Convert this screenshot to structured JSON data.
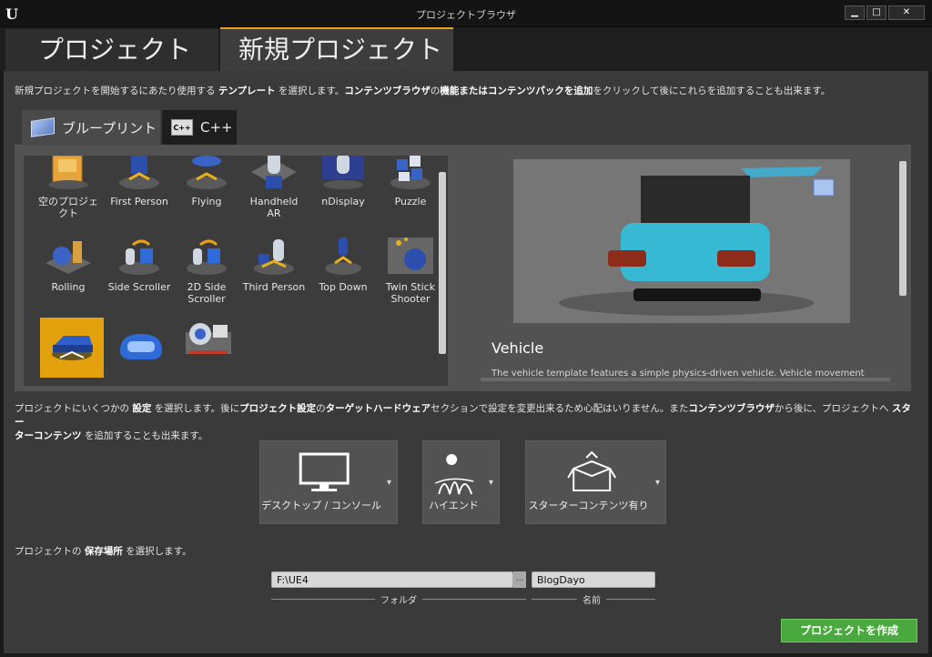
{
  "window": {
    "title": "プロジェクトブラウザ",
    "logo": "U",
    "min": "▁",
    "max": "□",
    "close": "✕"
  },
  "main_tabs": [
    {
      "label": "プロジェクト"
    },
    {
      "label": "新規プロジェクト"
    }
  ],
  "template_help": {
    "p1": "新規プロジェクトを開始するにあたり使用する ",
    "b1": "テンプレート",
    "p2": " を選択します。",
    "b2": "コンテンツブラウザ",
    "p3": "の",
    "b3": "機能またはコンテンツパックを追加",
    "p4": "をクリックして後にこれらを追加することも出来ます。"
  },
  "sub_tabs": [
    {
      "label": "ブループリント",
      "icon": "blueprint-icon"
    },
    {
      "label": "C++",
      "icon": "cpp-icon",
      "icon_text": "C++"
    }
  ],
  "templates": [
    {
      "label": "空のプロジェクト"
    },
    {
      "label": "First Person"
    },
    {
      "label": "Flying"
    },
    {
      "label": "Handheld AR"
    },
    {
      "label": "nDisplay"
    },
    {
      "label": "Puzzle"
    },
    {
      "label": "Rolling"
    },
    {
      "label": "Side Scroller"
    },
    {
      "label": "2D Side Scroller"
    },
    {
      "label": "Third Person"
    },
    {
      "label": "Top Down"
    },
    {
      "label": "Twin Stick Shooter"
    },
    {
      "label": ""
    },
    {
      "label": ""
    },
    {
      "label": ""
    }
  ],
  "preview": {
    "title": "Vehicle",
    "description": "The vehicle template features a simple physics-driven vehicle. Vehicle movement"
  },
  "settings_help": {
    "p1": "プロジェクトにいくつかの ",
    "b1": "設定",
    "p2": " を選択します。後に",
    "b2": "プロジェクト設定",
    "p3": "の",
    "b3": "ターゲットハードウェア",
    "p4": "セクションで設定を変更出来るため心配はいりません。また",
    "b4": "コンテンツブラウザ",
    "p5": "から後に、プロジェクトへ ",
    "b5": "スター",
    "b6": "ターコンテンツ",
    "p6": " を追加することも出来ます。"
  },
  "settings": [
    {
      "label": "デスクトップ / コンソール",
      "icon": "monitor-icon"
    },
    {
      "label": "ハイエンド",
      "icon": "high-quality-icon"
    },
    {
      "label": "スターターコンテンツ有り",
      "icon": "starter-content-box-icon"
    }
  ],
  "caret": "▾",
  "location_help": {
    "p1": "プロジェクトの ",
    "b1": "保存場所",
    "p2": " を選択します。"
  },
  "folder": {
    "value": "F:\\UE4",
    "browse": "...",
    "caption": "フォルダ"
  },
  "name": {
    "value": "BlogDayo",
    "caption": "名前"
  },
  "create_button": "プロジェクトを作成",
  "colors": {
    "accent": "#f0a014",
    "selected": "#e3a10d",
    "create": "#4aa93e"
  }
}
